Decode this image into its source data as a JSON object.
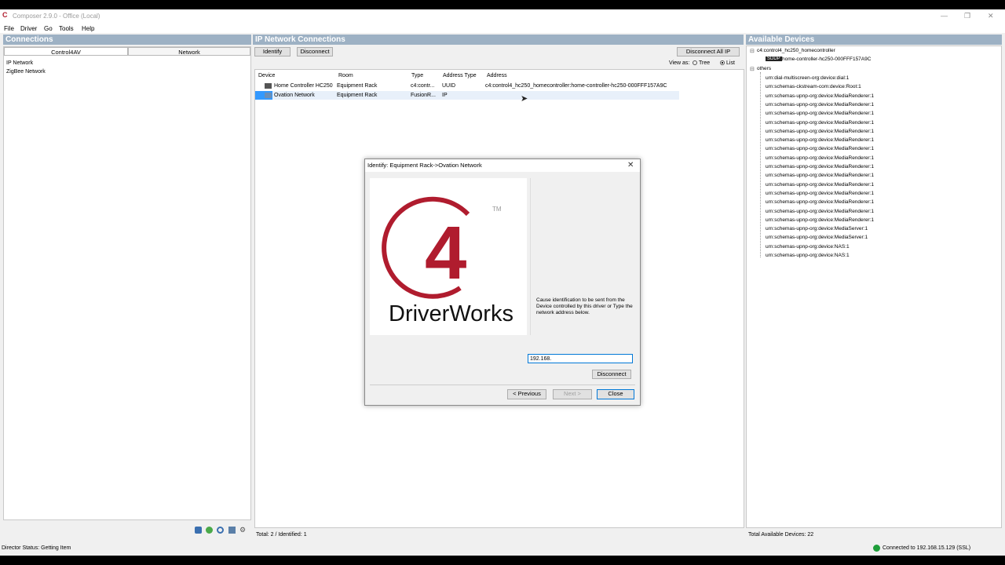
{
  "window": {
    "title": "Composer 2.9.0 - Office (Local)",
    "menu": [
      "File",
      "Driver",
      "Go",
      "Tools",
      "Help"
    ]
  },
  "connections": {
    "header": "Connections",
    "tabs": [
      "Control4AV",
      "Network"
    ],
    "items": [
      "IP Network",
      "ZigBee Network"
    ]
  },
  "ip": {
    "header": "IP Network Connections",
    "identify_label": "Identify",
    "disconnect_label": "Disconnect",
    "disconnect_all_label": "Disconnect All IP",
    "view_as_label": "View as:",
    "view_tree": "Tree",
    "view_list": "List",
    "columns": [
      "Device",
      "Room",
      "Type",
      "Address Type",
      "Address"
    ],
    "rows": [
      {
        "device": "Home Controller HC250",
        "room": "Equipment Rack",
        "type": "c4:contr...",
        "addr_type": "UUID",
        "address": "c4:control4_hc250_homecontroller:home-controller-hc250-000FFF157A9C"
      },
      {
        "device": "Ovation Network",
        "room": "Equipment Rack",
        "type": "FusionR...",
        "addr_type": "IP",
        "address": ""
      }
    ],
    "total": "Total: 2 / Identified: 1"
  },
  "available": {
    "header": "Available Devices",
    "root": "c4:control4_hc250_homecontroller",
    "root_child": "home-controller-hc250-000FFF157A9C",
    "root_child_badge": "SDDP",
    "others_label": "others",
    "others": [
      "urn:dial-multiscreen-org:device:dial:1",
      "urn:schemas-ckstream-com:device:Root:1",
      "urn:schemas-upnp-org:device:MediaRenderer:1",
      "urn:schemas-upnp-org:device:MediaRenderer:1",
      "urn:schemas-upnp-org:device:MediaRenderer:1",
      "urn:schemas-upnp-org:device:MediaRenderer:1",
      "urn:schemas-upnp-org:device:MediaRenderer:1",
      "urn:schemas-upnp-org:device:MediaRenderer:1",
      "urn:schemas-upnp-org:device:MediaRenderer:1",
      "urn:schemas-upnp-org:device:MediaRenderer:1",
      "urn:schemas-upnp-org:device:MediaRenderer:1",
      "urn:schemas-upnp-org:device:MediaRenderer:1",
      "urn:schemas-upnp-org:device:MediaRenderer:1",
      "urn:schemas-upnp-org:device:MediaRenderer:1",
      "urn:schemas-upnp-org:device:MediaRenderer:1",
      "urn:schemas-upnp-org:device:MediaRenderer:1",
      "urn:schemas-upnp-org:device:MediaRenderer:1",
      "urn:schemas-upnp-org:device:MediaServer:1",
      "urn:schemas-upnp-org:device:MediaServer:1",
      "urn:schemas-upnp-org:device:NAS:1",
      "urn:schemas-upnp-org:device:NAS:1"
    ],
    "total": "Total Available Devices: 22"
  },
  "dialog": {
    "title": "Identify: Equipment Rack->Ovation Network",
    "logo_text": "DriverWorks",
    "logo_tm": "TM",
    "logo_digit": "4",
    "instruction": "Cause identification to be sent from the Device controlled by this driver or Type the network address below.",
    "address_value": "192.168.",
    "disconnect_label": "Disconnect",
    "previous_label": "< Previous",
    "next_label": "Next >",
    "close_label": "Close"
  },
  "status": {
    "director": "Director Status: Getting Item",
    "connected": "Connected to 192.168.15.129 (SSL)"
  },
  "colors": {
    "panel_header": "#9db1c4",
    "c4_red": "#b01c2e",
    "selection": "#3399ff",
    "connected_green": "#1e9e3a"
  }
}
